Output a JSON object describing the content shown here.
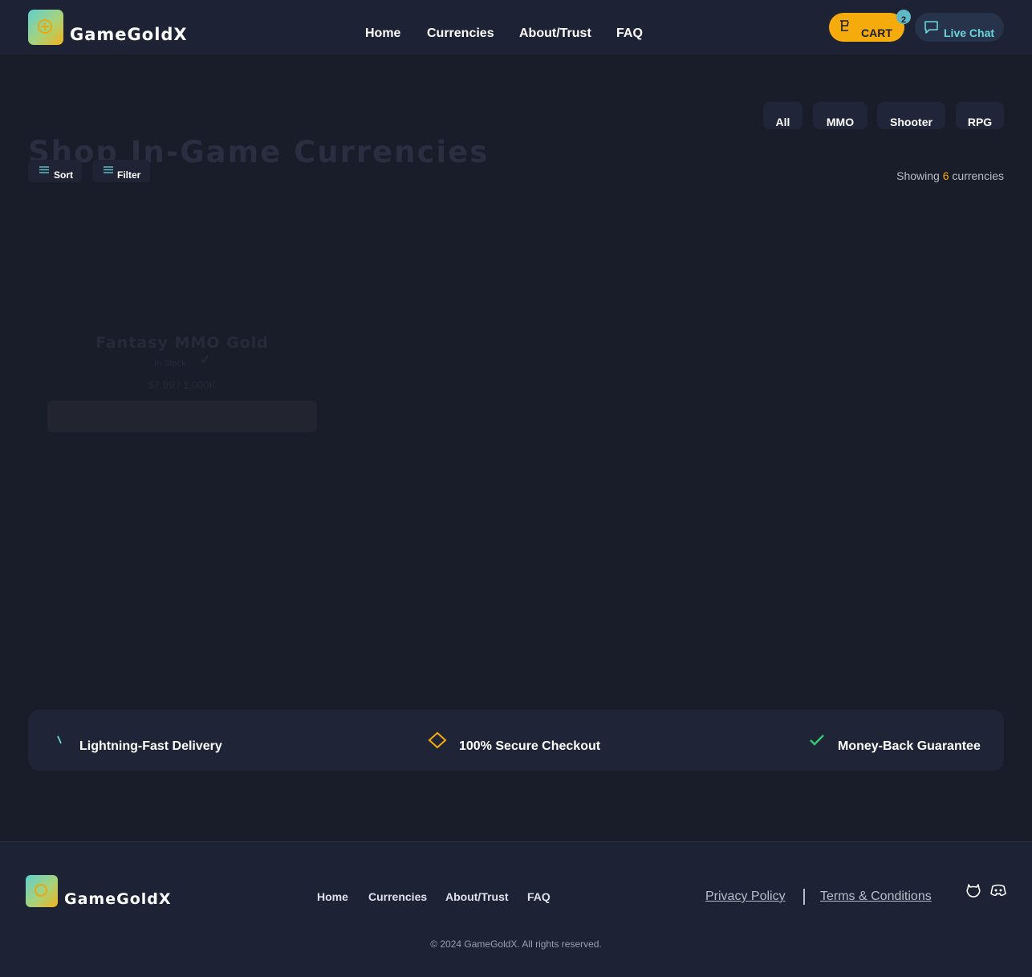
{
  "header": {
    "brand": "GameGoldX",
    "nav": [
      "Home",
      "Currencies",
      "About/Trust",
      "FAQ"
    ],
    "cart_label": "CART",
    "cart_count": "2",
    "chat_label": "Live Chat"
  },
  "main": {
    "title": "Shop In-Game Currencies",
    "categories": [
      "All",
      "MMO",
      "Shooter",
      "RPG"
    ],
    "sort_label": "Sort",
    "filter_label": "Filter",
    "showing_prefix": "Showing",
    "showing_count": "6",
    "showing_suffix": "currencies",
    "card": {
      "name": "Fantasy MMO Gold",
      "stock": "In Stock",
      "price": "$7.99 / 1,000K"
    }
  },
  "trust": {
    "items": [
      "Lightning-Fast Delivery",
      "100% Secure Checkout",
      "Money-Back Guarantee"
    ]
  },
  "footer": {
    "brand": "GameGoldX",
    "nav": [
      "Home",
      "Currencies",
      "About/Trust",
      "FAQ"
    ],
    "privacy": "Privacy Policy",
    "terms": "Terms & Conditions",
    "copyright": "© 2024 GameGoldX. All rights reserved."
  },
  "colors": {
    "background": "#191c29",
    "header": "#1e2235",
    "accent": "#f5ab0c",
    "teal": "#6ad5dc",
    "success": "#2ecc71"
  },
  "icons": [
    "coin-logo-icon",
    "cart-icon",
    "chat-icon",
    "menu-lines-icon",
    "bolt-icon",
    "diamond-icon",
    "check-icon",
    "github-icon",
    "discord-icon"
  ]
}
